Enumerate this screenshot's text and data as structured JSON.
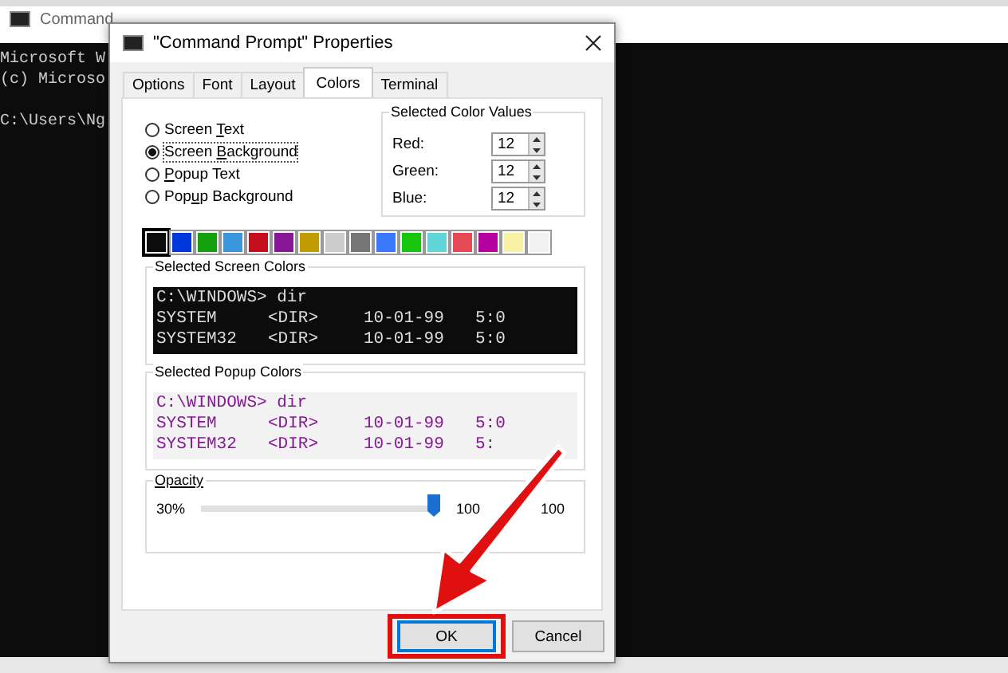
{
  "console": {
    "title": "Command",
    "lines": [
      "Microsoft W",
      "(c) Microso",
      "C:\\Users\\Ng"
    ]
  },
  "dialog": {
    "title": "\"Command Prompt\" Properties",
    "tabs": [
      {
        "label": "Options",
        "selected": false
      },
      {
        "label": "Font",
        "selected": false
      },
      {
        "label": "Layout",
        "selected": false
      },
      {
        "label": "Colors",
        "selected": true
      },
      {
        "label": "Terminal",
        "selected": false
      }
    ],
    "color_targets": [
      {
        "label": "Screen **T**ext",
        "selected": false
      },
      {
        "label": "Screen **B**ackground",
        "selected": true
      },
      {
        "label": "**P**opup Text",
        "selected": false
      },
      {
        "label": "Pop**u**p Background",
        "selected": false
      }
    ],
    "selected_color_values": {
      "title": "Selected Color Values",
      "fields": [
        {
          "label": "Red:",
          "value": "12"
        },
        {
          "label": "Green:",
          "value": "12"
        },
        {
          "label": "Blue:",
          "value": "12"
        }
      ]
    },
    "palette": [
      {
        "color": "#0c0c0c",
        "selected": true
      },
      {
        "color": "#0037da",
        "selected": false
      },
      {
        "color": "#13a10e",
        "selected": false
      },
      {
        "color": "#3a96dd",
        "selected": false
      },
      {
        "color": "#c50f1f",
        "selected": false
      },
      {
        "color": "#881798",
        "selected": false
      },
      {
        "color": "#c19c00",
        "selected": false
      },
      {
        "color": "#cccccc",
        "selected": false
      },
      {
        "color": "#767676",
        "selected": false
      },
      {
        "color": "#3b78ff",
        "selected": false
      },
      {
        "color": "#16c60c",
        "selected": false
      },
      {
        "color": "#61d6d6",
        "selected": false
      },
      {
        "color": "#e74856",
        "selected": false
      },
      {
        "color": "#b4009e",
        "selected": false
      },
      {
        "color": "#f9f1a5",
        "selected": false
      },
      {
        "color": "#f2f2f2",
        "selected": false
      }
    ],
    "screen_preview": {
      "title": "Selected Screen Colors",
      "prompt": "C:\\WINDOWS> dir",
      "rows": [
        [
          "SYSTEM",
          "<DIR>",
          "10-01-99",
          "5:0"
        ],
        [
          "SYSTEM32",
          "<DIR>",
          "10-01-99",
          "5:0"
        ]
      ]
    },
    "popup_preview": {
      "title": "Selected Popup Colors",
      "prompt": "C:\\WINDOWS> dir",
      "rows": [
        [
          "SYSTEM",
          "<DIR>",
          "10-01-99",
          "5:0"
        ],
        [
          "SYSTEM32",
          "<DIR>",
          "10-01-99",
          "5:"
        ]
      ]
    },
    "opacity": {
      "title": "Opacity",
      "min_label": "30%",
      "level": 1,
      "max_label": "100",
      "value": "100"
    },
    "buttons": [
      {
        "label": "OK",
        "highlighted": true
      },
      {
        "label": "Cancel",
        "highlighted": false
      }
    ]
  }
}
